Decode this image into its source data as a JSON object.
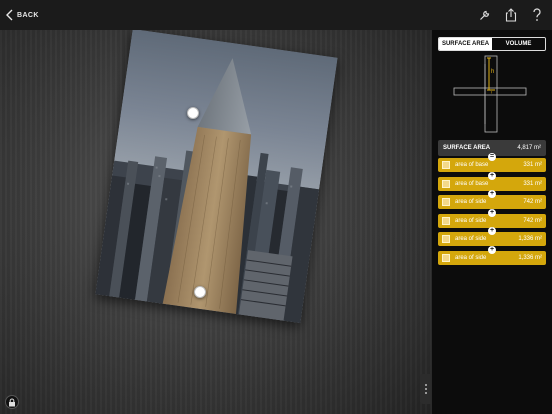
{
  "topbar": {
    "back_label": "BACK",
    "icons": [
      "wrench-icon",
      "share-icon",
      "help-icon"
    ]
  },
  "canvas": {
    "icons": [
      "lock-icon",
      "drag-handle-icon"
    ]
  },
  "panel": {
    "tabs": [
      {
        "label": "SURFACE AREA",
        "active": true
      },
      {
        "label": "VOLUME",
        "active": false
      }
    ],
    "diagram": {
      "h_label": "h",
      "l_label": "l"
    },
    "summary": {
      "label": "SURFACE AREA",
      "value": "4,817 m²"
    },
    "rows": [
      {
        "name": "area of base",
        "value": "331 m²",
        "op": "="
      },
      {
        "name": "area of base",
        "value": "331 m²",
        "op": "+"
      },
      {
        "name": "area of side",
        "value": "742 m²",
        "op": "+"
      },
      {
        "name": "area of side",
        "value": "742 m²",
        "op": "+"
      },
      {
        "name": "area of side",
        "value": "1,336 m²",
        "op": "+"
      },
      {
        "name": "area of side",
        "value": "1,336 m²",
        "op": "+"
      }
    ]
  },
  "colors": {
    "accent_yellow": "#d4a70c",
    "panel_bg": "#0c0c0c",
    "summary_bg": "#3a3a3a"
  }
}
